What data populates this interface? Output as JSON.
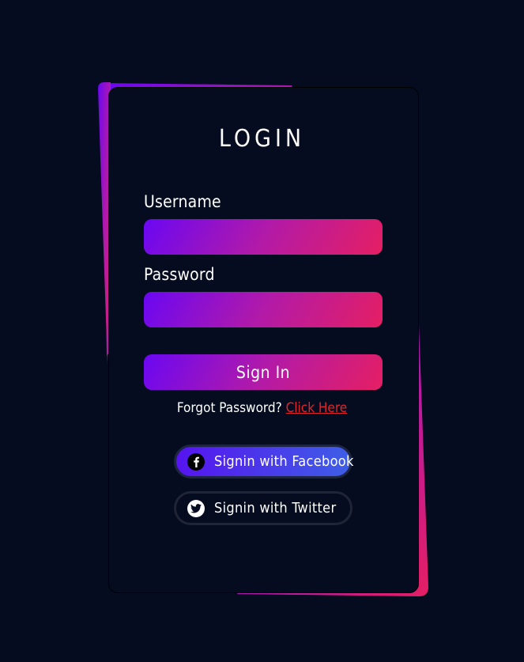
{
  "login": {
    "title": "LOGIN",
    "username_label": "Username",
    "password_label": "Password",
    "username_value": "",
    "password_value": "",
    "signin_label": "Sign In",
    "forgot_text": "Forgot Password?",
    "forgot_link": "Click Here",
    "facebook_label": "Signin with Facebook",
    "twitter_label": "Signin with Twitter"
  },
  "icons": {
    "facebook": "facebook-icon",
    "twitter": "twitter-icon"
  },
  "colors": {
    "background": "#050c1f",
    "gradient_start": "#6a07f3",
    "gradient_end": "#e51f63",
    "link": "#e3222a",
    "facebook_gradient_start": "#5614ef",
    "facebook_gradient_end": "#3e5ee6"
  }
}
